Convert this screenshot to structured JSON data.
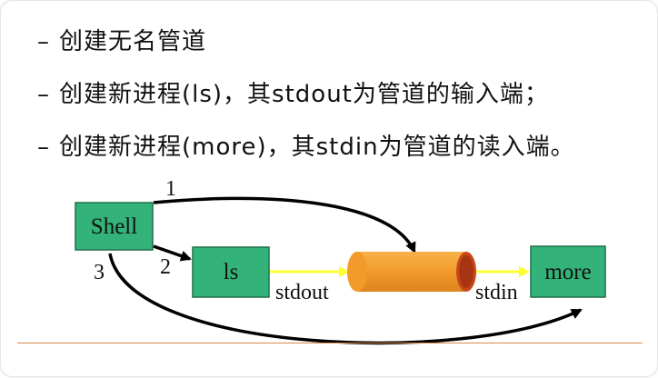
{
  "bullets": [
    {
      "dash": "–",
      "text": "创建无名管道"
    },
    {
      "dash": "–",
      "text": "创建新进程(ls)，其stdout为管道的输入端；"
    },
    {
      "dash": "–",
      "text": "创建新进程(more)，其stdin为管道的读入端。"
    }
  ],
  "diagram": {
    "nodes": {
      "shell": "Shell",
      "ls": "ls",
      "more": "more"
    },
    "edge_labels": {
      "one": "1",
      "two": "2",
      "three": "3",
      "stdout": "stdout",
      "stdin": "stdin"
    },
    "colors": {
      "box_fill": "#33b37a",
      "box_stroke": "#1f6f4a",
      "pipe_fill": "#f29b2a",
      "pipe_end": "#c9481a",
      "stream_arrow": "#ffff33",
      "control_arrow": "#000000"
    }
  }
}
